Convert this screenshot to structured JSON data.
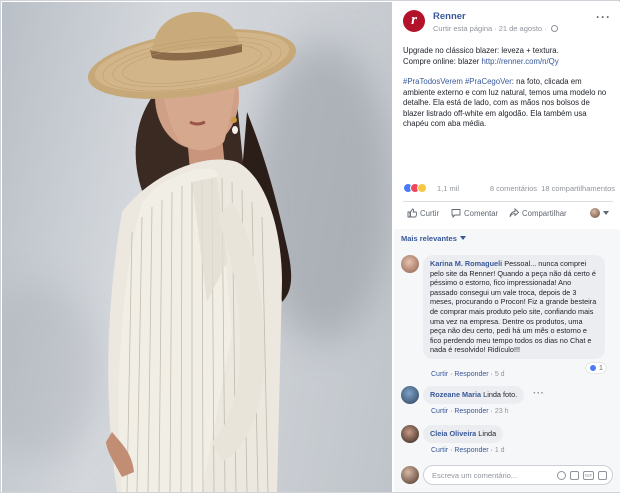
{
  "page": {
    "name": "Renner",
    "logo_letter": "r",
    "meta_label": "Curtir esta página",
    "date": "21 de agosto"
  },
  "post": {
    "line1": "Upgrade no clássico blazer: leveza + textura.",
    "line2_prefix": "Compre online: blazer ",
    "line2_link": "http://renner.com/n/Qy",
    "hashtags": "#PraTodosVerem #PraCegoVer",
    "body": ": na foto, clicada em ambiente externo e com luz natural, temos uma modelo no detalhe. Ela está de lado, com as mãos nos bolsos de blazer listrado off-white em algodão. Ela também usa chapéu com aba média."
  },
  "stats": {
    "reactions_count": "1,1 mil",
    "comments": "8 comentários",
    "shares": "18 compartilhamentos"
  },
  "actions": {
    "like": "Curtir",
    "comment": "Comentar",
    "share": "Compartilhar"
  },
  "comments_section": {
    "sort_label": "Mais relevantes",
    "write_placeholder": "Escreva um comentário...",
    "gif_label": "GIF"
  },
  "comments": [
    {
      "author": "Karina M. Romagueli",
      "text": "Pessoal... nunca comprei pelo site da Renner! Quando a peça não dá certo é péssimo o estorno, fico impressionada! Ano passado consegui um vale troca, depois de 3 meses, procurando o Procon! Fiz a grande besteira de comprar mais produto pelo site, confiando mais uma vez na empresa. Dentre os produtos, uma peça não deu certo, pedi há um mês o estorno e fico perdendo meu tempo todos os dias no Chat e nada é resolvido! Ridículo!!!",
      "like": "Curtir",
      "reply": "Responder",
      "time": "5 d",
      "likes": "1"
    },
    {
      "author": "Rozeane Maria",
      "text": "Linda foto.",
      "like": "Curtir",
      "reply": "Responder",
      "time": "23 h"
    },
    {
      "author": "Cleia Oliveira",
      "text": "Linda",
      "like": "Curtir",
      "reply": "Responder",
      "time": "1 d"
    }
  ],
  "colors": {
    "brand": "#b3132a",
    "link": "#385898",
    "muted": "#90949c"
  },
  "icons": [
    "globe-icon",
    "more-icon",
    "like-icon",
    "comment-icon",
    "share-icon",
    "camera-icon",
    "gif-icon",
    "sticker-icon",
    "emoji-icon"
  ]
}
